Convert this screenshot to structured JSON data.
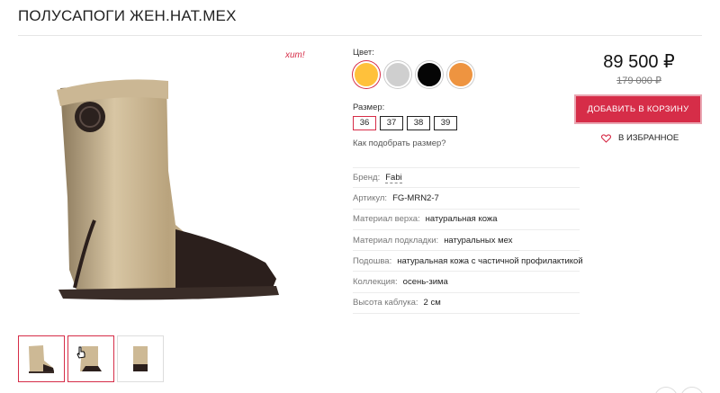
{
  "product": {
    "title": "ПОЛУСАПОГИ ЖЕН.НАТ.МЕХ",
    "badge": "хит!"
  },
  "options": {
    "color_label": "Цвет:",
    "colors": [
      "#ffc13b",
      "#cfcfcf",
      "#050505",
      "#ee9440"
    ],
    "selected_color": 0,
    "size_label": "Размер:",
    "sizes": [
      "36",
      "37",
      "38",
      "39"
    ],
    "selected_size": 0,
    "size_help": "Как подобрать размер?"
  },
  "properties": [
    {
      "key": "Бренд:",
      "value": "Fabi"
    },
    {
      "key": "Артикул:",
      "value": "FG-MRN2-7"
    },
    {
      "key": "Материал верха:",
      "value": "натуральная кожа"
    },
    {
      "key": "Материал подкладки:",
      "value": "натуральных мех"
    },
    {
      "key": "Подошва:",
      "value": "натуральная кожа с частичной профилактикой"
    },
    {
      "key": "Коллекция:",
      "value": "осень-зима"
    },
    {
      "key": "Высота каблука:",
      "value": "2 см"
    }
  ],
  "pricing": {
    "price": "89 500 ₽",
    "old_price": "179 000 ₽",
    "cart_button": "ДОБАВИТЬ В КОРЗИНУ",
    "favorite": "В ИЗБРАННОЕ",
    "accent": "#d62d48"
  },
  "gallery": {
    "thumbnails": [
      "boot-front",
      "boot-angle",
      "boot-side"
    ],
    "active": 0
  }
}
